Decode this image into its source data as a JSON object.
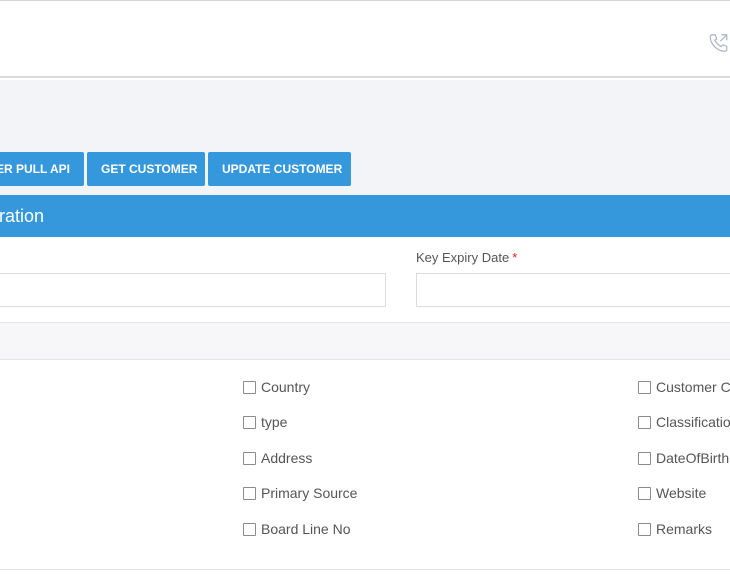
{
  "toolbar": {
    "buttons": [
      {
        "label": "ER PULL API"
      },
      {
        "label": "GET CUSTOMER"
      },
      {
        "label": "UPDATE CUSTOMER"
      }
    ]
  },
  "panel": {
    "title": "ration",
    "fields": [
      {
        "label": "",
        "value": ""
      },
      {
        "label": "Key Expiry Date",
        "required_mark": "*",
        "value": ""
      }
    ],
    "columns": [
      {
        "items": [
          "Country",
          "type",
          "Address",
          "Primary Source",
          "Board Line No"
        ]
      },
      {
        "items": [
          "Customer C",
          "Classificatio",
          "DateOfBirth",
          "Website",
          "Remarks"
        ]
      }
    ]
  },
  "colors": {
    "accent": "#3598dc",
    "page_background": "#f3f4f8",
    "required": "#e02222"
  },
  "icons": {
    "header_right": "phone-icon"
  }
}
